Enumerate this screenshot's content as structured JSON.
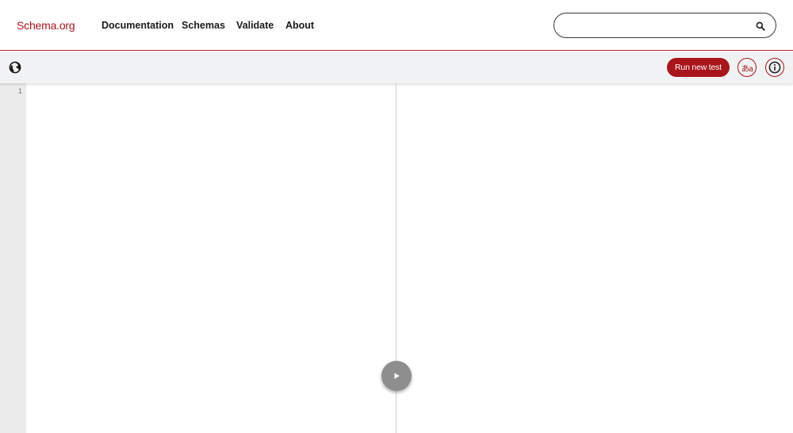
{
  "header": {
    "logo": "Schema.org",
    "nav": [
      {
        "label": "Documentation"
      },
      {
        "label": "Schemas"
      },
      {
        "label": "Validate"
      },
      {
        "label": "About"
      }
    ],
    "search": {
      "value": "",
      "placeholder": ""
    }
  },
  "toolbar": {
    "run_label": "Run new test",
    "lang_glyph": "あa"
  },
  "editor": {
    "line_numbers": [
      "1"
    ]
  },
  "icons": {
    "globe": "globe-icon",
    "search": "search-icon",
    "language": "language-icon",
    "info": "info-icon",
    "play": "play-icon"
  },
  "colors": {
    "brand": "#a8161b",
    "toolbar_bg": "#f1f2f3",
    "gutter_bg": "#ebebeb",
    "play_bg": "#8e8e8e"
  }
}
